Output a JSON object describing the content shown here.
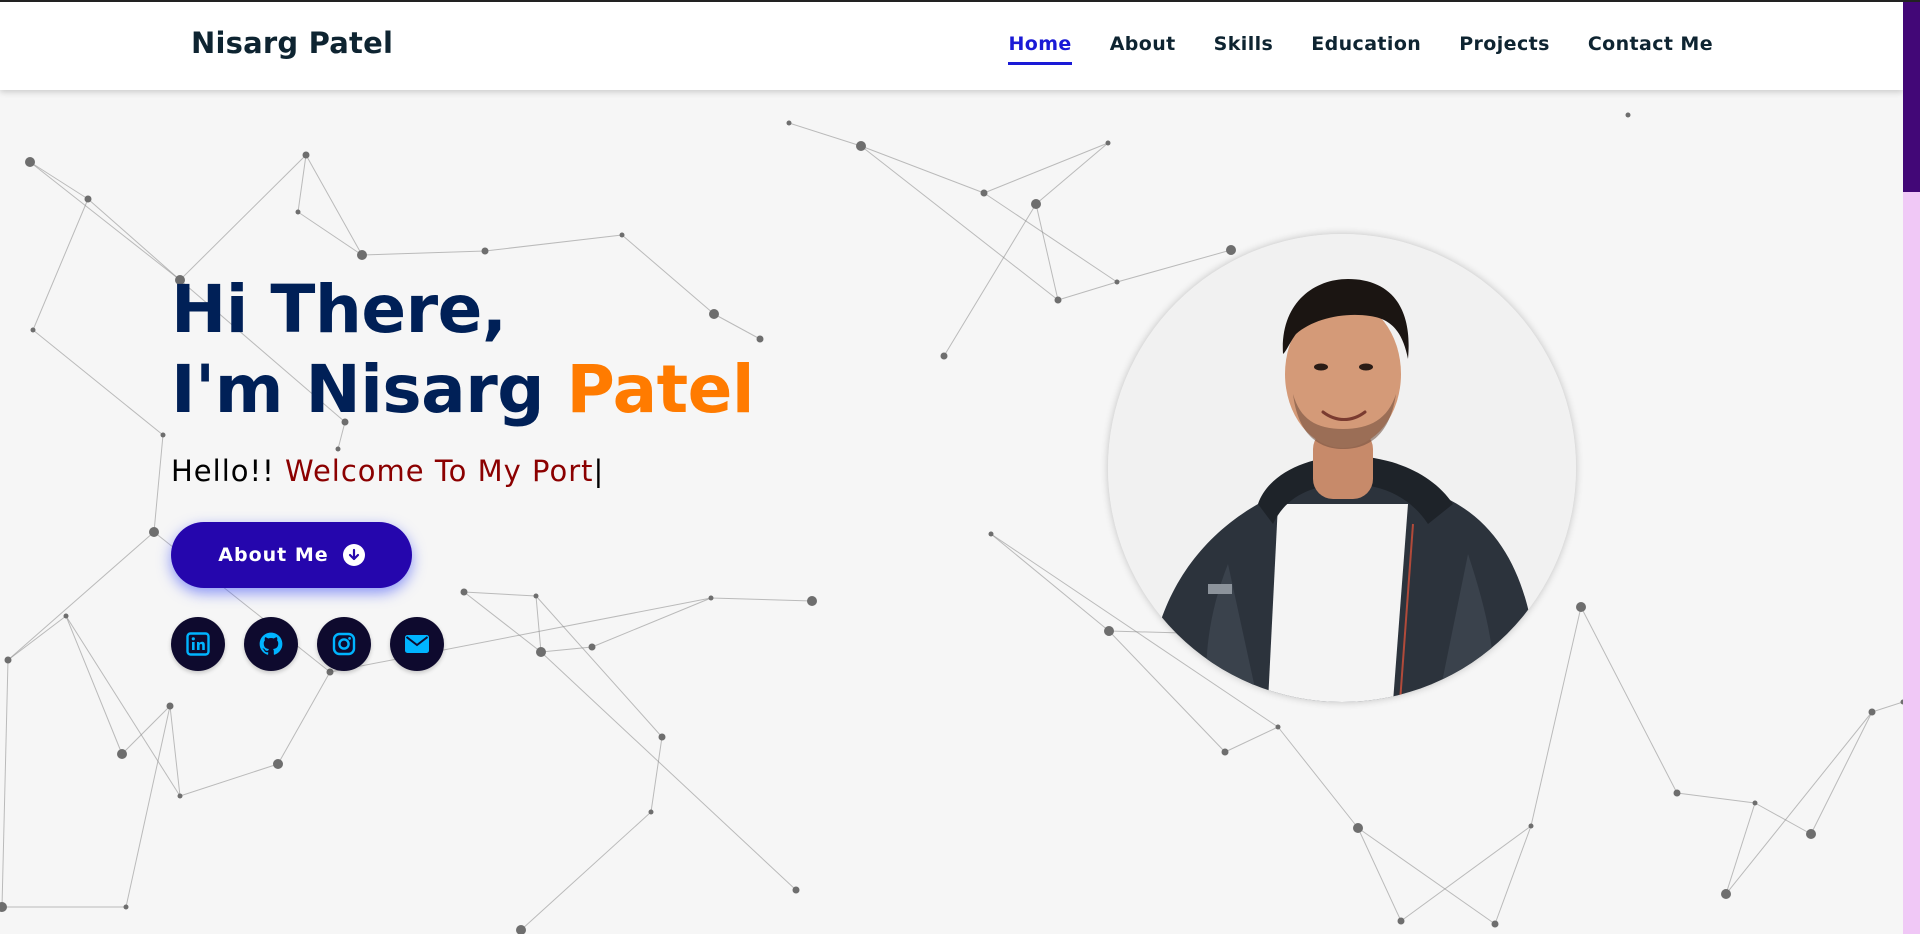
{
  "navbar": {
    "brand": "Nisarg Patel",
    "links": [
      {
        "label": "Home",
        "active": true
      },
      {
        "label": "About",
        "active": false
      },
      {
        "label": "Skills",
        "active": false
      },
      {
        "label": "Education",
        "active": false
      },
      {
        "label": "Projects",
        "active": false
      },
      {
        "label": "Contact Me",
        "active": false
      }
    ]
  },
  "hero": {
    "line1": "Hi There,",
    "line2_prefix": "I'm Nisarg ",
    "line2_accent": "Patel",
    "greeting": "Hello!! ",
    "typed_text": "Welcome To My Port",
    "cursor": "|",
    "button_label": "About Me",
    "socials": [
      {
        "icon": "linkedin-icon"
      },
      {
        "icon": "github-icon"
      },
      {
        "icon": "instagram-icon"
      },
      {
        "icon": "email-icon"
      }
    ]
  },
  "colors": {
    "title": "#002057",
    "accent": "#ff7b00",
    "typed": "#8b0000",
    "button": "#2506ad",
    "nav_active": "#1a1ad6",
    "social_bg": "#0e0a2e",
    "social_icon": "#00b4ff",
    "scroll_thumb": "#420777",
    "scroll_track": "#f0c8f6"
  }
}
